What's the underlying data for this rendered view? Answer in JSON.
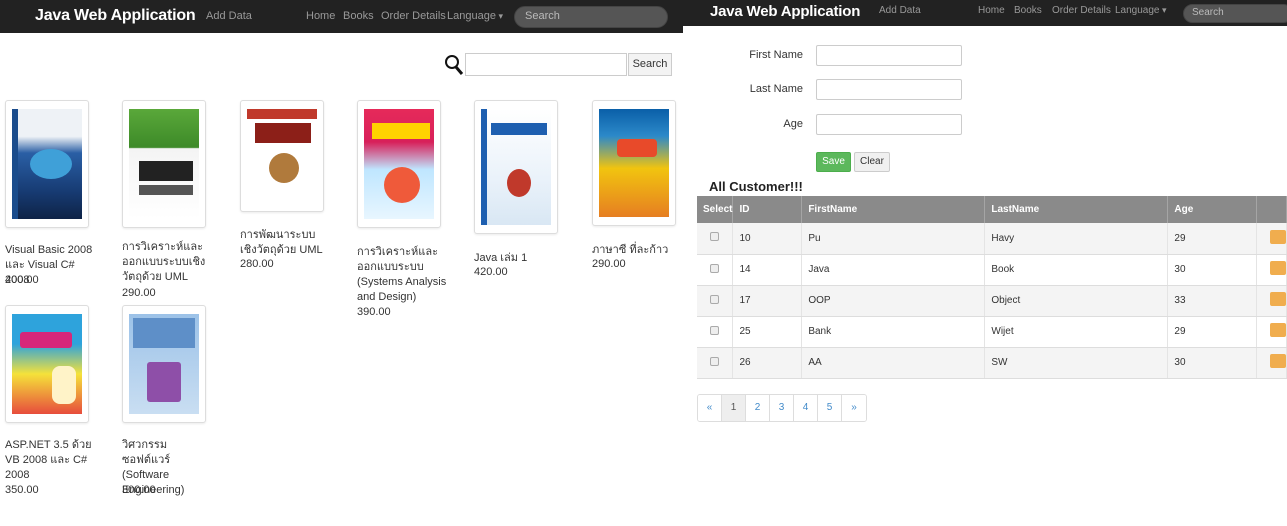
{
  "left": {
    "nav": {
      "brand": "Java Web Application",
      "items": [
        "Add Data",
        "Home",
        "Books",
        "Order Details",
        "Language"
      ],
      "search_placeholder": "Search"
    },
    "search": {
      "button": "Search"
    },
    "books": [
      {
        "title": "Visual Basic 2008 และ Visual C# 2008",
        "price": "400.00"
      },
      {
        "title": "การวิเคราะห์และออกแบบระบบเชิงวัตถุด้วย UML",
        "price": "290.00"
      },
      {
        "title": "การพัฒนาระบบเชิงวัตถุด้วย UML",
        "price": "280.00"
      },
      {
        "title": "การวิเคราะห์และออกแบบระบบ (Systems Analysis and Design)",
        "price": "390.00"
      },
      {
        "title": "Java เล่ม 1",
        "price": "420.00"
      },
      {
        "title": "ภาษาซี ที่ละก้าว",
        "price": "290.00"
      },
      {
        "title": "ASP.NET 3.5 ด้วย VB 2008 และ C# 2008",
        "price": "350.00"
      },
      {
        "title": "วิศวกรรมซอฟต์แวร์ (Software Engineering)",
        "price": "300.00"
      }
    ]
  },
  "right": {
    "nav": {
      "brand": "Java Web Application",
      "items": [
        "Add Data",
        "Home",
        "Books",
        "Order Details",
        "Language"
      ],
      "search_placeholder": "Search"
    },
    "form": {
      "first_name_label": "First Name",
      "last_name_label": "Last Name",
      "age_label": "Age",
      "save": "Save",
      "clear": "Clear"
    },
    "table_title": "All Customer!!!",
    "columns": [
      "Select",
      "ID",
      "FirstName",
      "LastName",
      "Age"
    ],
    "rows": [
      [
        "10",
        "Pu",
        "Havy",
        "29"
      ],
      [
        "14",
        "Java",
        "Book",
        "30"
      ],
      [
        "17",
        "OOP",
        "Object",
        "33"
      ],
      [
        "25",
        "Bank",
        "Wijet",
        "29"
      ],
      [
        "26",
        "AA",
        "SW",
        "30"
      ]
    ],
    "pager": [
      "«",
      "1",
      "2",
      "3",
      "4",
      "5",
      "»"
    ]
  }
}
